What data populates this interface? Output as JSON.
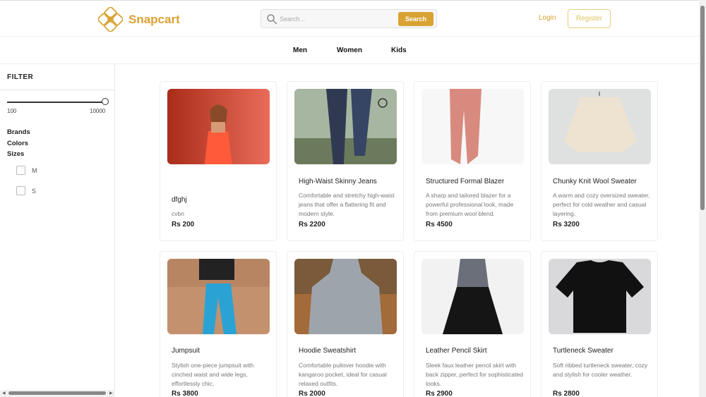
{
  "brand": {
    "name": "Snapcart"
  },
  "search": {
    "placeholder": "Search...",
    "button_label": "Search"
  },
  "auth": {
    "login_label": "Login",
    "register_label": "Register"
  },
  "categories": [
    "Men",
    "Women",
    "Kids"
  ],
  "filter": {
    "title": "FILTER",
    "price_min": "100",
    "price_max": "10000",
    "facets": [
      "Brands",
      "Colors",
      "Sizes"
    ],
    "sizes": [
      "M",
      "S"
    ]
  },
  "products": [
    {
      "title": "dfghj",
      "description": "cvbn",
      "price": "Rs 200"
    },
    {
      "title": "High-Waist Skinny Jeans",
      "description": "Comfortable and stretchy high-waist jeans that offer a flattering fit and modern style.",
      "price": "Rs 2200"
    },
    {
      "title": "Structured Formal Blazer",
      "description": "A sharp and tailored blazer for a powerful professional look, made from premium wool blend.",
      "price": "Rs 4500"
    },
    {
      "title": "Chunky Knit Wool Sweater",
      "description": "A warm and cozy oversized sweater, perfect for cold weather and casual layering.",
      "price": "Rs 3200"
    },
    {
      "title": "Jumpsuit",
      "description": "Stylish one-piece jumpsuit with cinched waist and wide legs, effortlessly chic.",
      "price": "Rs 3800"
    },
    {
      "title": "Hoodie Sweatshirt",
      "description": "Comfortable pullover hoodie with kangaroo pocket, ideal for casual relaxed outfits.",
      "price": "Rs 2000"
    },
    {
      "title": "Leather Pencil Skirt",
      "description": "Sleek faux leather pencil skirt with back zipper, perfect for sophisticated looks.",
      "price": "Rs 2900"
    },
    {
      "title": "Turtleneck Sweater",
      "description": "Soft ribbed turtleneck sweater, cozy and stylish for cooler weather.",
      "price": "Rs 2800"
    }
  ],
  "colors": {
    "accent": "#d9a334",
    "text": "#222222",
    "muted": "#777777"
  }
}
